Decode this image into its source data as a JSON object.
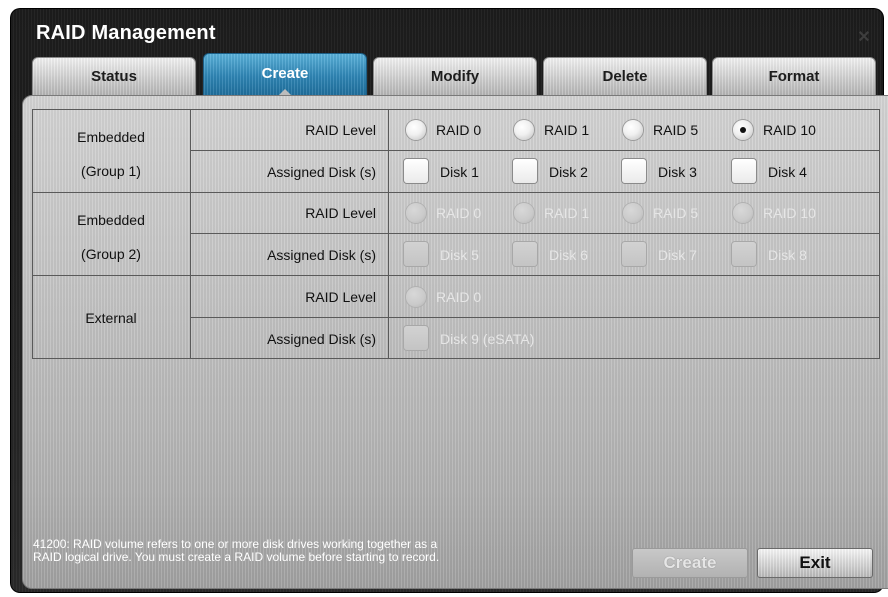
{
  "window": {
    "title": "RAID Management"
  },
  "tabs": [
    "Status",
    "Create",
    "Modify",
    "Delete",
    "Format"
  ],
  "active_tab": "Create",
  "groups": [
    {
      "name_line1": "Embedded",
      "name_line2": "(Group 1)"
    },
    {
      "name_line1": "Embedded",
      "name_line2": "(Group 2)"
    },
    {
      "name_line1": "External",
      "name_line2": ""
    }
  ],
  "row_labels": {
    "raid_level": "RAID Level",
    "assigned_disks": "Assigned Disk (s)"
  },
  "group1": {
    "raid_options": [
      "RAID 0",
      "RAID 1",
      "RAID 5",
      "RAID 10"
    ],
    "selected_raid": "RAID 10",
    "disks": [
      "Disk 1",
      "Disk 2",
      "Disk 3",
      "Disk 4"
    ]
  },
  "group2": {
    "raid_options": [
      "RAID 0",
      "RAID 1",
      "RAID 5",
      "RAID 10"
    ],
    "disks": [
      "Disk 5",
      "Disk 6",
      "Disk 7",
      "Disk 8"
    ]
  },
  "external": {
    "raid_options": [
      "RAID 0"
    ],
    "disks": [
      "Disk 9 (eSATA)"
    ]
  },
  "status_message": "41200: RAID volume refers to one or more disk drives working together as a RAID logical drive. You must create a RAID volume before starting to record.",
  "buttons": {
    "create": "Create",
    "exit": "Exit"
  },
  "icons": {
    "close": "close-icon"
  }
}
